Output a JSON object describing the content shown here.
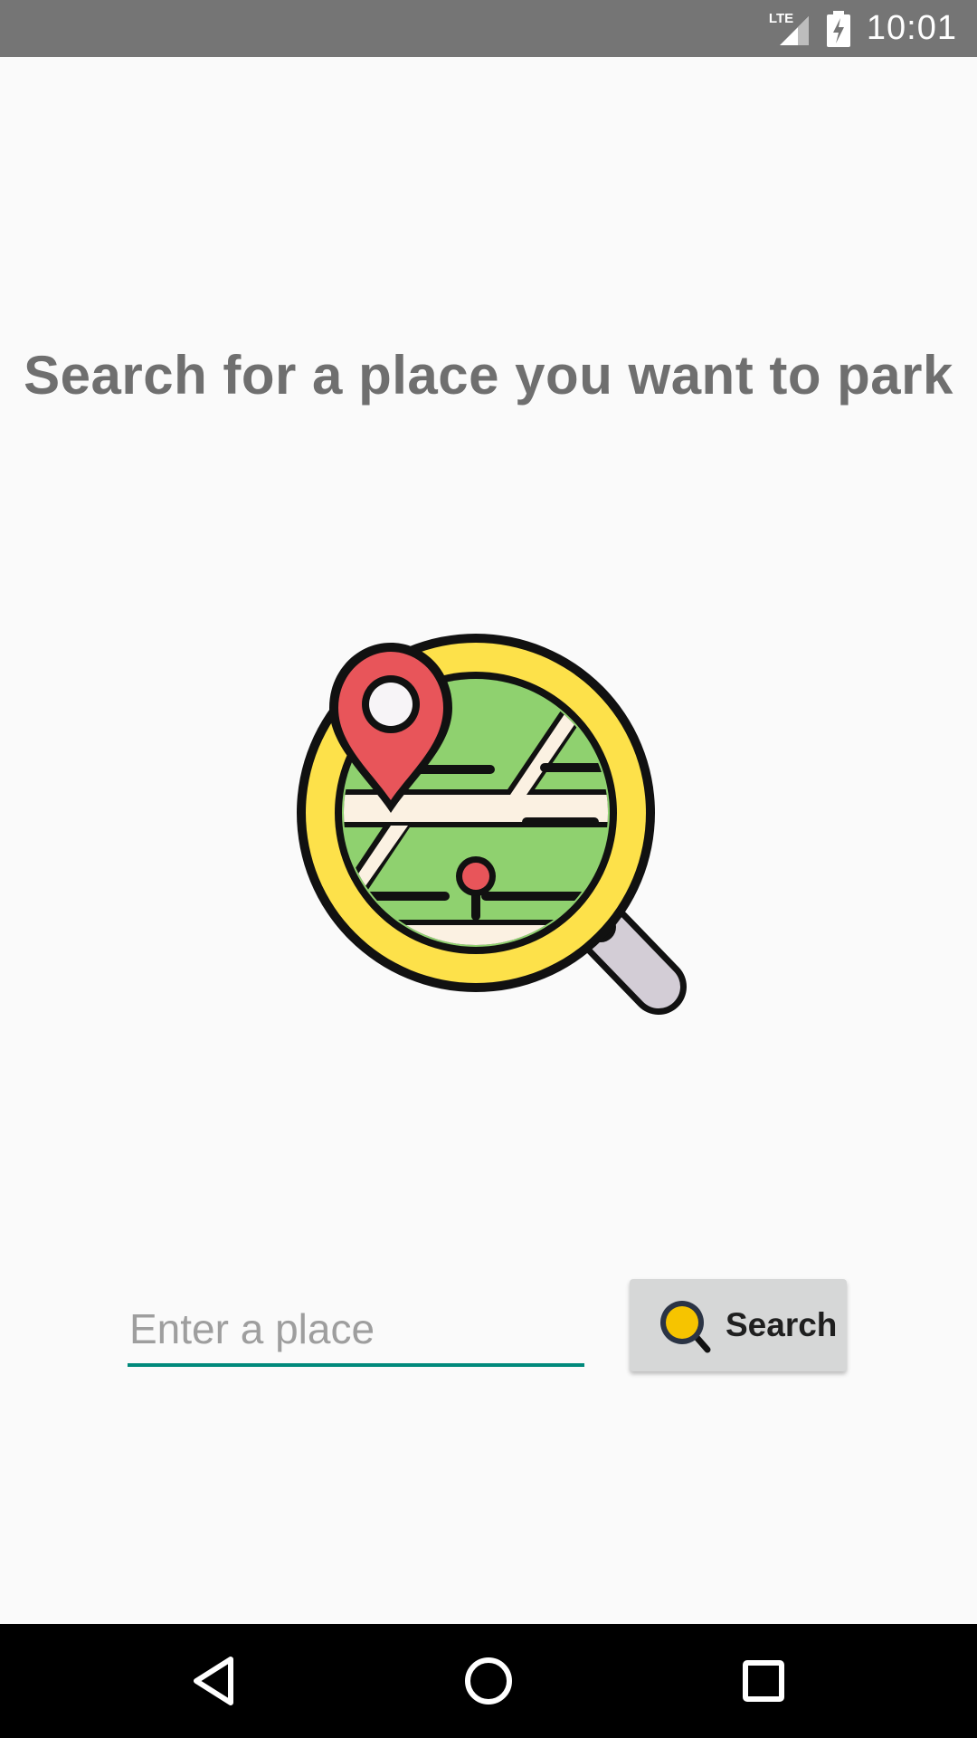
{
  "status_bar": {
    "network": "LTE",
    "time": "10:01",
    "icons": [
      "signal-icon",
      "battery-charging-icon"
    ]
  },
  "main": {
    "headline": "Search for a place you want to park",
    "illustration_icon": "map-search-icon"
  },
  "search": {
    "placeholder": "Enter a place",
    "value": "",
    "button_label": "Search",
    "button_icon": "magnifier-icon"
  },
  "nav_bar": {
    "icons": [
      "back-icon",
      "home-icon",
      "recents-icon"
    ]
  },
  "colors": {
    "status_bar": "#757575",
    "background": "#fafafa",
    "headline": "#6f6f6f",
    "input_underline": "#00897b",
    "button_bg": "#d6d7d7",
    "nav_bar": "#000000"
  }
}
